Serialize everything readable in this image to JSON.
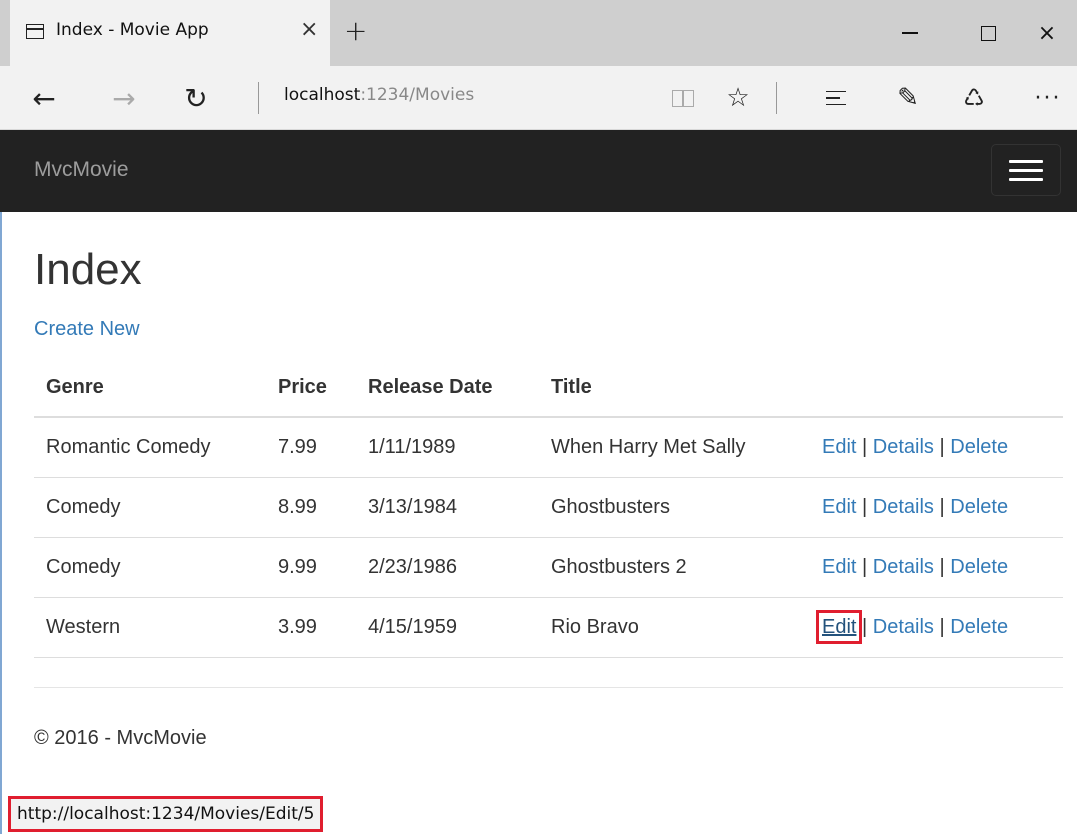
{
  "browser": {
    "tab_title": "Index - Movie App",
    "tab_close": "×",
    "new_tab": "+",
    "window_close": "×",
    "address_host": "localhost",
    "address_path": ":1234/Movies",
    "icons": {
      "page": "page-icon",
      "back": "back-arrow-icon",
      "forward": "forward-arrow-icon",
      "refresh": "refresh-icon",
      "reading_view": "reading-view-icon",
      "favorites": "star-icon",
      "hub": "hub-icon",
      "web_note": "web-note-icon",
      "share": "share-icon",
      "more": "more-icon"
    },
    "back_glyph": "←",
    "forward_glyph": "→",
    "refresh_glyph": "↻",
    "favorite_glyph": "☆",
    "note_glyph": "✎",
    "share_glyph": "♺",
    "more_glyph": "···",
    "status_url": "http://localhost:1234/Movies/Edit/5"
  },
  "site": {
    "brand": "MvcMovie",
    "nav_bg": "#222222",
    "link_color": "#337ab7"
  },
  "page": {
    "title": "Index",
    "create_new": "Create New",
    "footer": "© 2016 - MvcMovie"
  },
  "table": {
    "headers": [
      "Genre",
      "Price",
      "Release Date",
      "Title"
    ],
    "rows": [
      {
        "genre": "Romantic Comedy",
        "price": "7.99",
        "release_date": "1/11/1989",
        "title": "When Harry Met Sally",
        "edit": "Edit",
        "details": "Details",
        "delete": "Delete"
      },
      {
        "genre": "Comedy",
        "price": "8.99",
        "release_date": "3/13/1984",
        "title": "Ghostbusters",
        "edit": "Edit",
        "details": "Details",
        "delete": "Delete"
      },
      {
        "genre": "Comedy",
        "price": "9.99",
        "release_date": "2/23/1986",
        "title": "Ghostbusters 2",
        "edit": "Edit",
        "details": "Details",
        "delete": "Delete"
      },
      {
        "genre": "Western",
        "price": "3.99",
        "release_date": "4/15/1959",
        "title": "Rio Bravo",
        "edit": "Edit",
        "details": "Details",
        "delete": "Delete"
      }
    ],
    "separator": "|"
  },
  "highlight_color": "#e01e2f"
}
